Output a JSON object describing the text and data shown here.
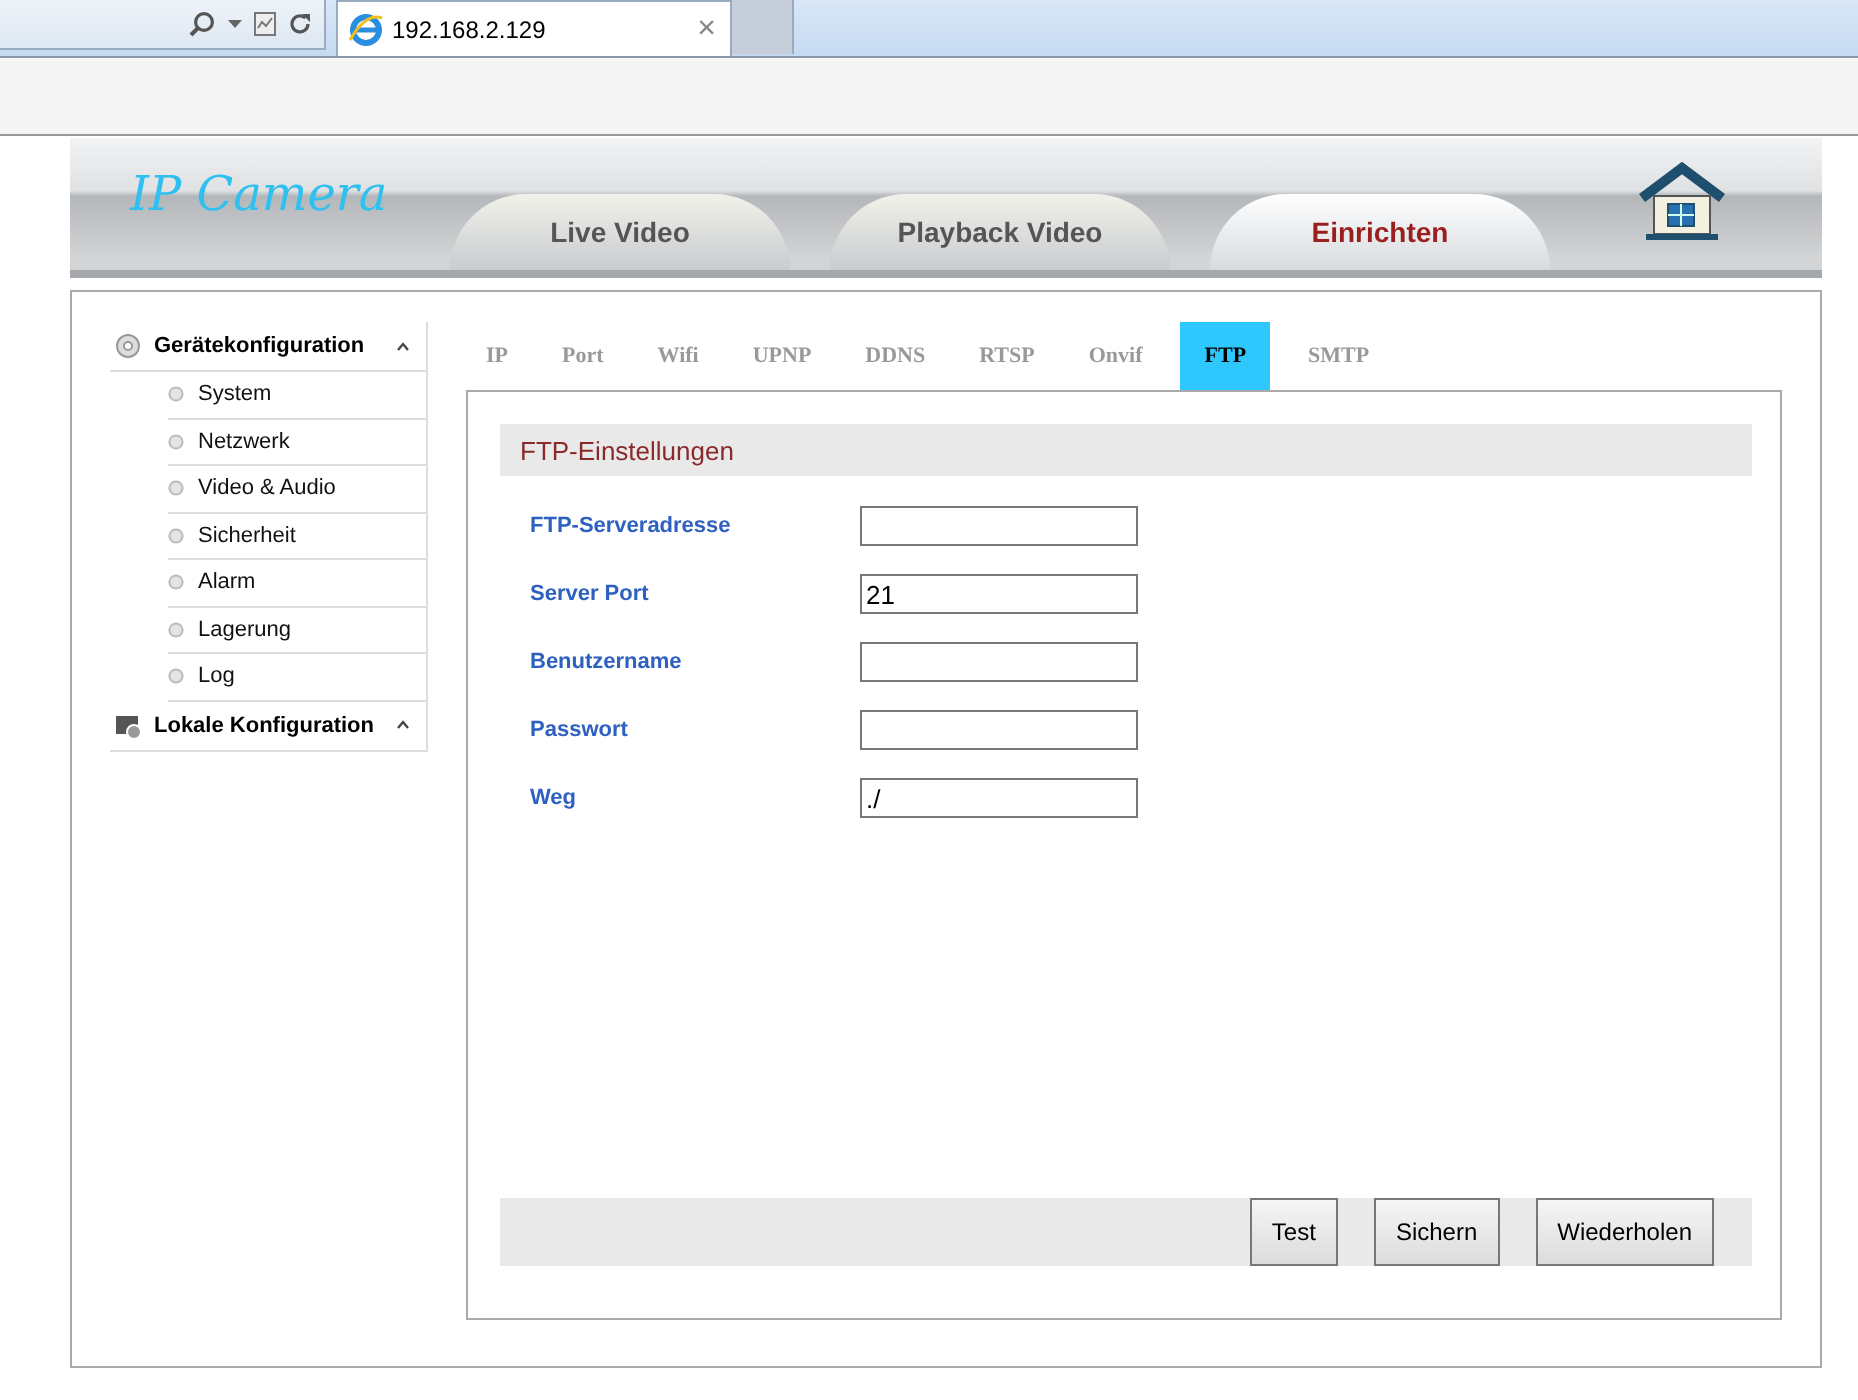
{
  "browser": {
    "tab_title": "192.168.2.129",
    "tab_close": "×"
  },
  "header": {
    "logo": "IP Camera",
    "nav_tabs": [
      {
        "label": "Live Video",
        "selected": false
      },
      {
        "label": "Playback Video",
        "selected": false
      },
      {
        "label": "Einrichten",
        "selected": true
      }
    ]
  },
  "sidebar": {
    "groups": [
      {
        "label": "Gerätekonfiguration",
        "kind": "device",
        "children": [
          {
            "label": "System"
          },
          {
            "label": "Netzwerk"
          },
          {
            "label": "Video & Audio"
          },
          {
            "label": "Sicherheit"
          },
          {
            "label": "Alarm"
          },
          {
            "label": "Lagerung"
          },
          {
            "label": "Log"
          }
        ]
      },
      {
        "label": "Lokale Konfiguration",
        "kind": "local"
      }
    ]
  },
  "sub_tabs": [
    {
      "label": "IP",
      "selected": false
    },
    {
      "label": "Port",
      "selected": false
    },
    {
      "label": "Wifi",
      "selected": false
    },
    {
      "label": "UPNP",
      "selected": false
    },
    {
      "label": "DDNS",
      "selected": false
    },
    {
      "label": "RTSP",
      "selected": false
    },
    {
      "label": "Onvif",
      "selected": false
    },
    {
      "label": "FTP",
      "selected": true
    },
    {
      "label": "SMTP",
      "selected": false
    }
  ],
  "section": {
    "title": "FTP-Einstellungen",
    "fields": [
      {
        "label": "FTP-Serveradresse"
      },
      {
        "label": "Server Port",
        "value": "21"
      },
      {
        "label": "Benutzername"
      },
      {
        "label": "Passwort"
      },
      {
        "label": "Weg",
        "value": "./"
      }
    ]
  },
  "buttons": [
    "Test",
    "Sichern",
    "Wiederholen"
  ]
}
